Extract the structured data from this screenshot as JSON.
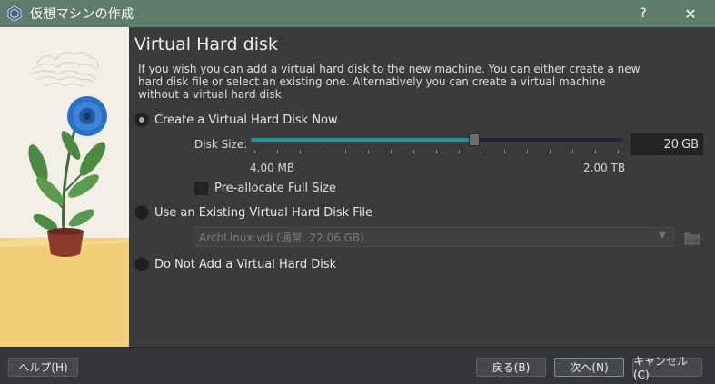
{
  "window": {
    "title": "仮想マシンの作成",
    "help_label": "?",
    "close_label": "✕"
  },
  "page": {
    "title": "Virtual Hard disk",
    "description": "If you wish you can add a virtual hard disk to the new machine. You can either create a new hard disk file or select an existing one. Alternatively you can create a virtual machine without a virtual hard disk."
  },
  "options": {
    "create_now": {
      "label": "Create a Virtual Hard Disk Now",
      "selected": true
    },
    "use_existing": {
      "label": "Use an Existing Virtual Hard Disk File",
      "selected": false
    },
    "no_disk": {
      "label": "Do Not Add a Virtual Hard Disk",
      "selected": false
    }
  },
  "disk_size": {
    "label": "Disk Size:",
    "value": "20",
    "unit": "GB",
    "range_min": "4.00 MB",
    "range_max": "2.00 TB",
    "slider_fraction": 0.6
  },
  "preallocate": {
    "label": "Pre-allocate Full Size",
    "checked": false
  },
  "existing_file": {
    "selected": "ArchLinux.vdi (通常, 22.06 GB)"
  },
  "footer": {
    "help": "ヘルプ(H)",
    "back": "戻る(B)",
    "next": "次へ(N)",
    "cancel": "キャンセル(C)"
  },
  "colors": {
    "titlebar": "#5f7c6e",
    "accent": "#2f8d90",
    "background": "#3a3b3d"
  }
}
